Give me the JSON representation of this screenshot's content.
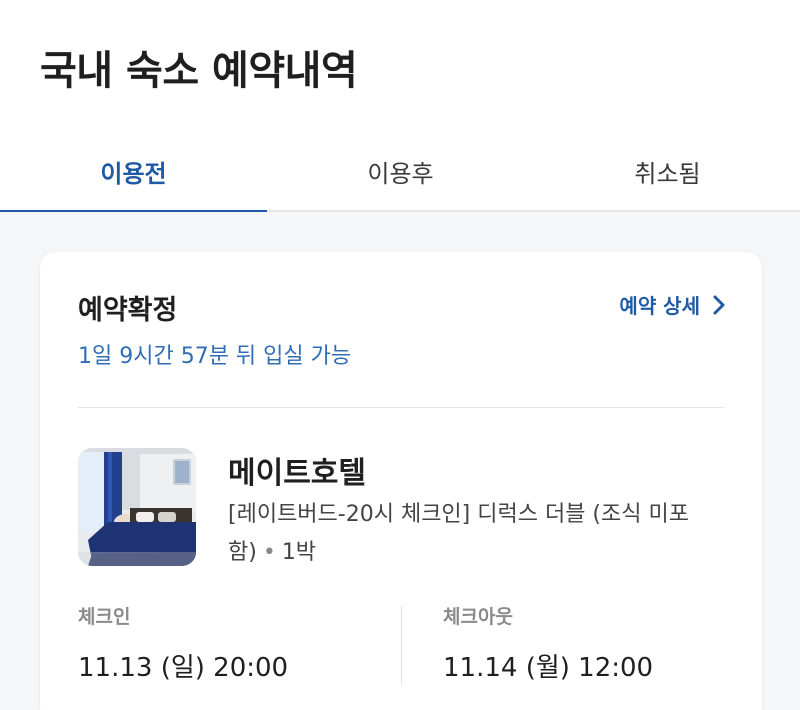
{
  "header": {
    "title": "국내 숙소 예약내역"
  },
  "tabs": [
    {
      "label": "이용전",
      "active": true
    },
    {
      "label": "이용후",
      "active": false
    },
    {
      "label": "취소됨",
      "active": false
    }
  ],
  "reservation": {
    "status": "예약확정",
    "detail_link": "예약 상세",
    "countdown": "1일 9시간 57분 뒤 입실 가능",
    "hotel_name": "메이트호텔",
    "room_desc": "[레이트버드-20시 체크인] 디럭스 더블 (조식 미포함)",
    "nights": "1박",
    "checkin": {
      "label": "체크인",
      "value": "11.13 (일) 20:00"
    },
    "checkout": {
      "label": "체크아웃",
      "value": "11.14 (월) 12:00"
    }
  },
  "colors": {
    "accent": "#1f5aa6",
    "countdown": "#2f6db5"
  }
}
